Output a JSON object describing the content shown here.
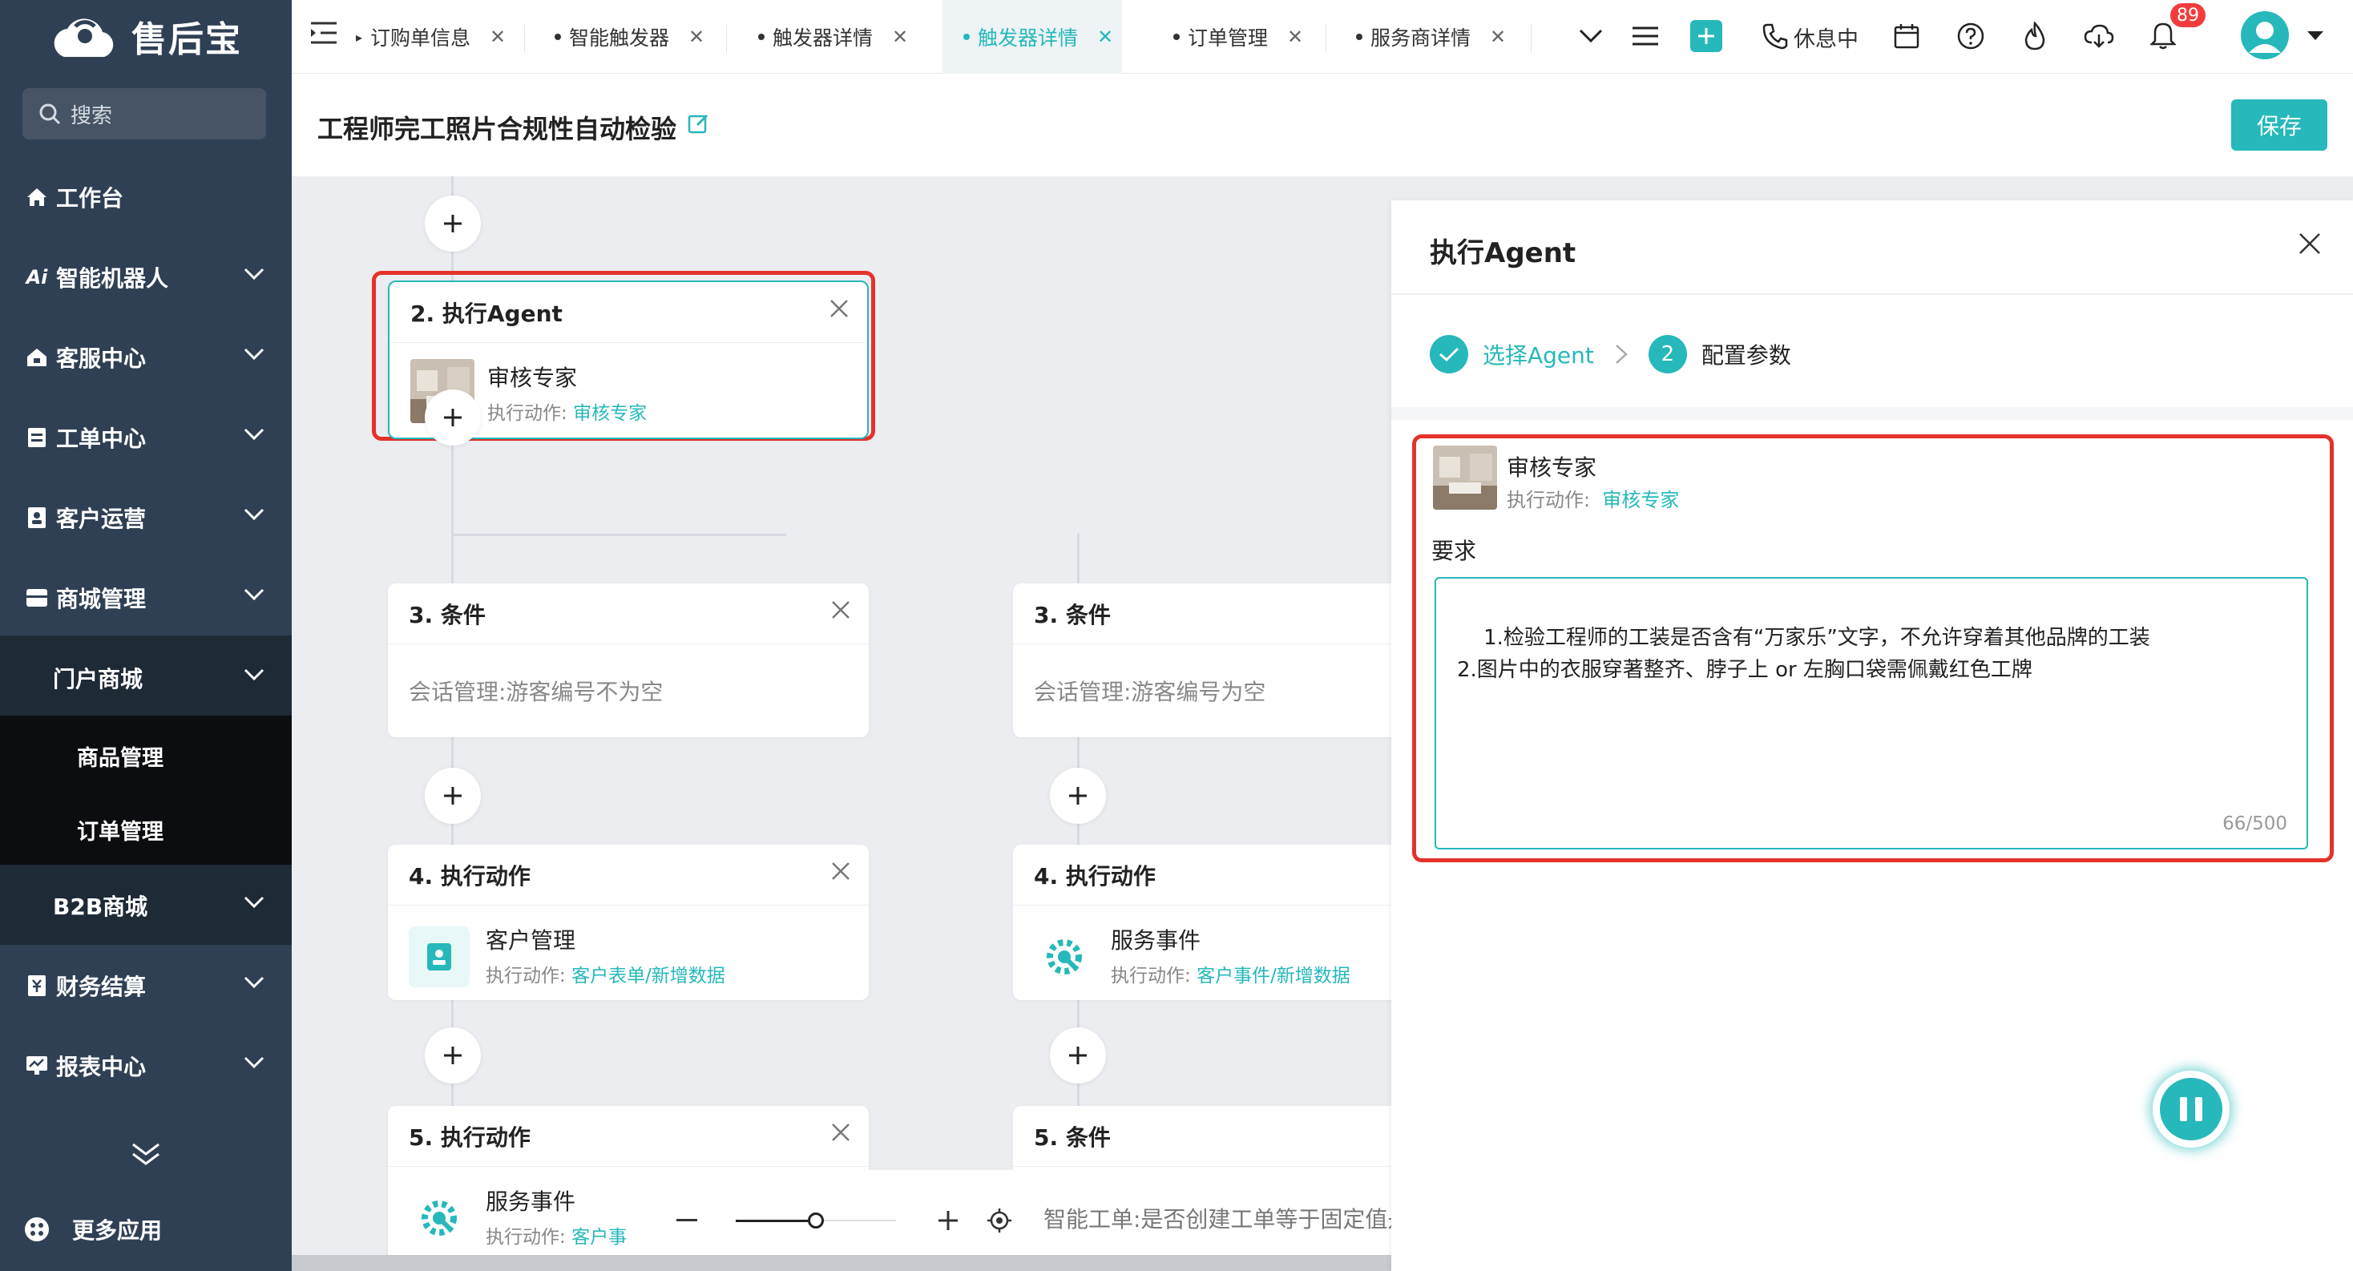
{
  "brand": {
    "name": "售后宝",
    "accent": "#26b8ba",
    "sidebar_bg": "#304054"
  },
  "search": {
    "placeholder": "搜索"
  },
  "sidebar": {
    "items": [
      {
        "label": "工作台",
        "icon": "home-icon"
      },
      {
        "label": "智能机器人",
        "icon": "ai-icon"
      },
      {
        "label": "客服中心",
        "icon": "service-icon"
      },
      {
        "label": "工单中心",
        "icon": "ticket-icon"
      },
      {
        "label": "客户运营",
        "icon": "customer-icon"
      },
      {
        "label": "商城管理",
        "icon": "mall-icon"
      },
      {
        "label": "门户商城",
        "icon": ""
      },
      {
        "label": "商品管理",
        "icon": ""
      },
      {
        "label": "订单管理",
        "icon": ""
      },
      {
        "label": "B2B商城",
        "icon": ""
      },
      {
        "label": "财务结算",
        "icon": "finance-icon"
      },
      {
        "label": "报表中心",
        "icon": "report-icon"
      }
    ],
    "more_apps": "更多应用"
  },
  "tabs": [
    {
      "label": "订购单信息"
    },
    {
      "label": "智能触发器"
    },
    {
      "label": "触发器详情"
    },
    {
      "label": "触发器详情",
      "active": true
    },
    {
      "label": "订单管理"
    },
    {
      "label": "服务商详情"
    }
  ],
  "topbar": {
    "status": "休息中",
    "notification_count": "89"
  },
  "page": {
    "title": "工程师完工照片合规性自动检验",
    "save_label": "保存"
  },
  "flow": {
    "agent_node": {
      "title": "2.  执行Agent",
      "name": "审核专家",
      "action_label": "执行动作:",
      "action_value": "审核专家"
    },
    "cond_left": {
      "title": "3.  条件",
      "text": "会话管理:游客编号不为空"
    },
    "cond_right": {
      "title": "3.  条件",
      "text": "会话管理:游客编号为空"
    },
    "action_left": {
      "title": "4.  执行动作",
      "name": "客户管理",
      "action_label": "执行动作:",
      "action_value": "客户表单/新增数据"
    },
    "action_right": {
      "title": "4.  执行动作",
      "name": "服务事件",
      "action_label": "执行动作:",
      "action_value": "客户事件/新增数据"
    },
    "action_left5": {
      "title": "5.  执行动作",
      "name": "服务事件",
      "action_label": "执行动作:",
      "action_value": "客户事"
    },
    "cond_right5": {
      "title": "5.  条件",
      "text": "智能工单:是否创建工单等于固定值是"
    }
  },
  "panel": {
    "title": "执行Agent",
    "step1": "选择Agent",
    "step2_num": "2",
    "step2": "配置参数",
    "agent_name": "审核专家",
    "agent_action_label": "执行动作:",
    "agent_action_value": "审核专家",
    "requirement_label": "要求",
    "requirement_text": "1.检验工程师的工装是否含有“万家乐”文字，不允许穿着其他品牌的工装\n2.图片中的衣服穿著整齐、脖子上 or 左胸口袋需佩戴红色工牌",
    "char_count": "66/500"
  }
}
